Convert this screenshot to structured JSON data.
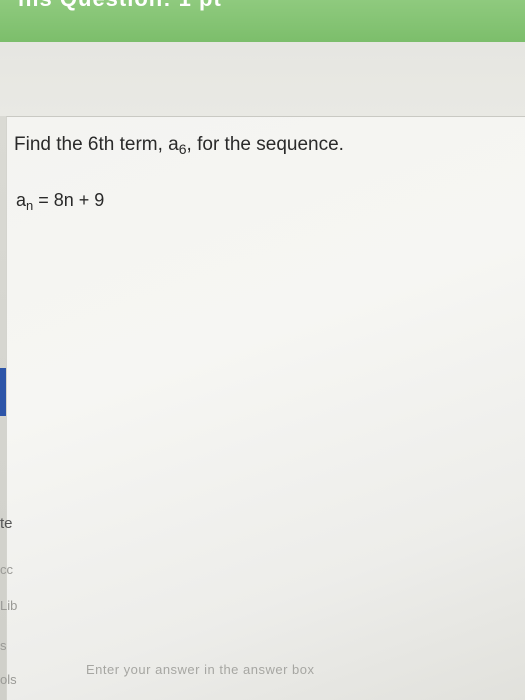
{
  "header": {
    "cut_title": "his Question: 1 pt"
  },
  "question": {
    "prompt_before": "Find the 6th term, a",
    "prompt_subscript": "6",
    "prompt_after": ", for the sequence.",
    "formula_base": "a",
    "formula_subscript": "n",
    "formula_rest": " = 8n + 9"
  },
  "sidebar_fragments": {
    "item1": "te",
    "item2": "cc",
    "item3": "Lib",
    "item4": "s",
    "item5": "ols"
  },
  "answer": {
    "placeholder": "Enter your answer in the answer box"
  },
  "colors": {
    "header_green": "#7cbe6b",
    "side_tab_blue": "#2d55a8"
  }
}
